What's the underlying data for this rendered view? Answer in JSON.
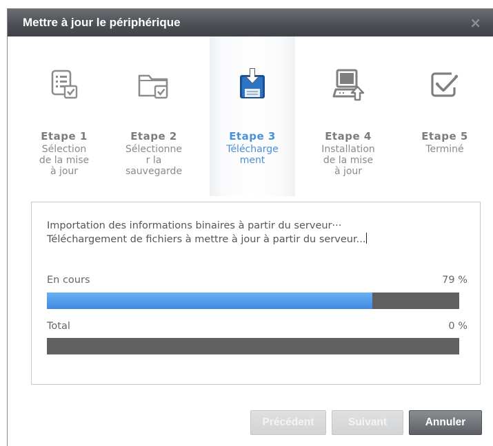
{
  "window": {
    "title": "Mettre à jour le périphérique",
    "close_glyph": "×"
  },
  "steps": [
    {
      "title": "Etape 1",
      "desc": "Sélection\nde la mise\nà jour",
      "icon": "list-check-icon",
      "active": false
    },
    {
      "title": "Etape 2",
      "desc": "Sélectionne\nr la\nsauvegarde",
      "icon": "folder-check-icon",
      "active": false
    },
    {
      "title": "Etape 3",
      "desc": "Télécharge\nment",
      "icon": "download-floppy-icon",
      "active": true
    },
    {
      "title": "Etape 4",
      "desc": "Installation\nde la mise\nà jour",
      "icon": "computer-upload-icon",
      "active": false
    },
    {
      "title": "Etape 5",
      "desc": "Terminé",
      "icon": "checkbox-icon",
      "active": false
    }
  ],
  "messages": {
    "line1": "Importation des informations binaires à partir du serveur···",
    "line2": "Téléchargement de fichiers à mettre à jour à partir du serveur..."
  },
  "progress": {
    "current": {
      "label": "En cours",
      "value_text": "79 %",
      "value": 0.79
    },
    "total": {
      "label": "Total",
      "value_text": "0 %",
      "value": 0
    }
  },
  "buttons": {
    "previous": "Précédent",
    "next": "Suivant",
    "cancel": "Annuler"
  },
  "colors": {
    "accent": "#4a8fd8",
    "progress_fill": "#3f8be0",
    "progress_track": "#606060",
    "titlebar": "#4d5156"
  }
}
